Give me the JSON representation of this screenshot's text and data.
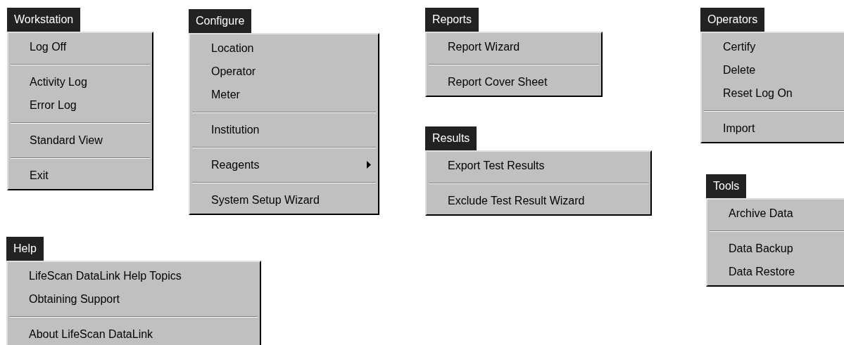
{
  "menus": [
    {
      "title": "Workstation",
      "items": [
        {
          "kind": "item",
          "label": "Log Off",
          "submenu": false
        },
        {
          "kind": "separator"
        },
        {
          "kind": "item",
          "label": "Activity Log",
          "submenu": false
        },
        {
          "kind": "item",
          "label": "Error Log",
          "submenu": false
        },
        {
          "kind": "separator"
        },
        {
          "kind": "item",
          "label": "Standard View",
          "submenu": false
        },
        {
          "kind": "separator"
        },
        {
          "kind": "item",
          "label": "Exit",
          "submenu": false
        }
      ]
    },
    {
      "title": "Configure",
      "items": [
        {
          "kind": "item",
          "label": "Location",
          "submenu": false
        },
        {
          "kind": "item",
          "label": "Operator",
          "submenu": false
        },
        {
          "kind": "item",
          "label": "Meter",
          "submenu": false
        },
        {
          "kind": "separator"
        },
        {
          "kind": "item",
          "label": "Institution",
          "submenu": false
        },
        {
          "kind": "separator"
        },
        {
          "kind": "item",
          "label": "Reagents",
          "submenu": true
        },
        {
          "kind": "separator"
        },
        {
          "kind": "item",
          "label": "System Setup Wizard",
          "submenu": false
        }
      ]
    },
    {
      "title": "Reports",
      "items": [
        {
          "kind": "item",
          "label": "Report Wizard",
          "submenu": false
        },
        {
          "kind": "separator"
        },
        {
          "kind": "item",
          "label": "Report Cover Sheet",
          "submenu": false
        }
      ]
    },
    {
      "title": "Results",
      "items": [
        {
          "kind": "item",
          "label": "Export Test Results",
          "submenu": false
        },
        {
          "kind": "separator"
        },
        {
          "kind": "item",
          "label": "Exclude Test Result Wizard",
          "submenu": false
        }
      ]
    },
    {
      "title": "Operators",
      "items": [
        {
          "kind": "item",
          "label": "Certify",
          "submenu": false
        },
        {
          "kind": "item",
          "label": "Delete",
          "submenu": false
        },
        {
          "kind": "item",
          "label": "Reset Log On",
          "submenu": false
        },
        {
          "kind": "separator"
        },
        {
          "kind": "item",
          "label": "Import",
          "submenu": false
        }
      ]
    },
    {
      "title": "Tools",
      "items": [
        {
          "kind": "item",
          "label": "Archive Data",
          "submenu": false
        },
        {
          "kind": "separator"
        },
        {
          "kind": "item",
          "label": "Data Backup",
          "submenu": false
        },
        {
          "kind": "item",
          "label": "Data Restore",
          "submenu": false
        }
      ]
    },
    {
      "title": "Help",
      "items": [
        {
          "kind": "item",
          "label": "LifeScan DataLink Help Topics",
          "submenu": false
        },
        {
          "kind": "item",
          "label": "Obtaining Support",
          "submenu": false
        },
        {
          "kind": "separator"
        },
        {
          "kind": "item",
          "label": "About LifeScan DataLink",
          "submenu": false
        }
      ]
    }
  ]
}
